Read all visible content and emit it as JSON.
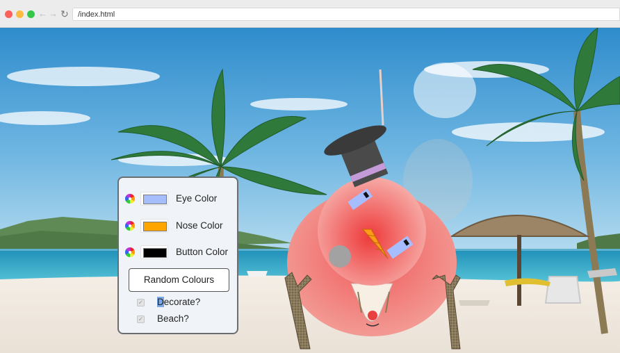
{
  "browser": {
    "url": "/index.html",
    "back_glyph": "←",
    "forward_glyph": "→",
    "reload_glyph": "↻"
  },
  "panel": {
    "color_rows": [
      {
        "label": "Eye Color",
        "value": "#a6bdff",
        "icon": "color-wheel-icon"
      },
      {
        "label": "Nose Color",
        "value": "#ffa500",
        "icon": "color-wheel-icon"
      },
      {
        "label": "Button Color",
        "value": "#000000",
        "icon": "color-wheel-icon"
      }
    ],
    "random_button": "Random Colours",
    "checkboxes": [
      {
        "label_first": "D",
        "label_rest": "ecorate?",
        "checked": true
      },
      {
        "label_first": "",
        "label_rest": "Beach?",
        "checked": true
      }
    ]
  },
  "colors": {
    "snowman_body": "#f08080",
    "hat": "#444444",
    "hat_band": "#c49ad8"
  }
}
